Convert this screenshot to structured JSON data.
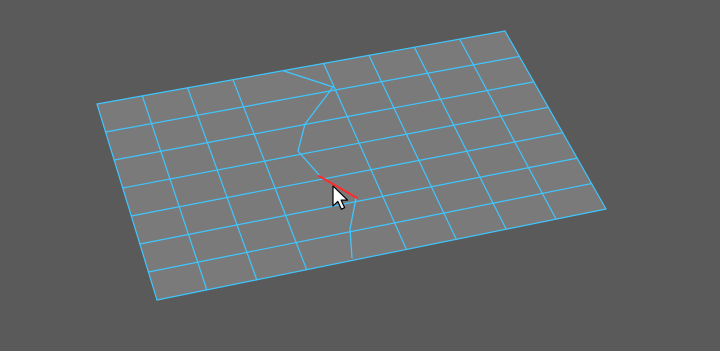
{
  "viewport": {
    "background_color": "#5a5a5a"
  },
  "mesh": {
    "face_color": "#7a7a7a",
    "wire_color": "#3fc6ff",
    "seam_color": "#3fc6ff",
    "selected_edge_color": "#ff2a2a",
    "columns": 9,
    "rows": 7
  },
  "cursor": {
    "icon": "arrow-cursor-icon",
    "fill_color": "#ffffff",
    "outline_color": "#000000"
  }
}
